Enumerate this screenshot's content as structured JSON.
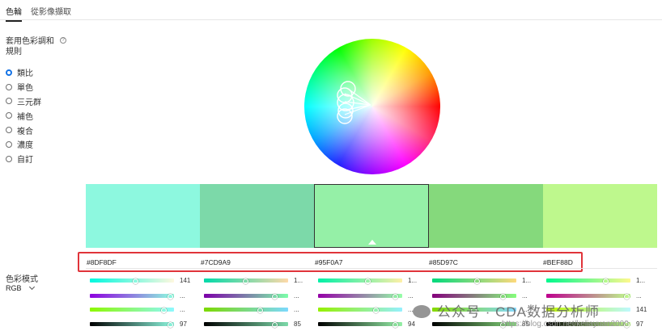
{
  "tabs": [
    {
      "label": "色輪",
      "active": true
    },
    {
      "label": "從影像擷取",
      "active": false
    }
  ],
  "harmony": {
    "title": "套用色彩調和規則",
    "rules": [
      {
        "label": "類比",
        "checked": true
      },
      {
        "label": "單色",
        "checked": false
      },
      {
        "label": "三元群",
        "checked": false
      },
      {
        "label": "補色",
        "checked": false
      },
      {
        "label": "複合",
        "checked": false
      },
      {
        "label": "濃度",
        "checked": false
      },
      {
        "label": "自訂",
        "checked": false
      }
    ]
  },
  "swatches": [
    {
      "hex": "#8DF8DF",
      "color": "#8DF8DF"
    },
    {
      "hex": "#7CD9A9",
      "color": "#7CD9A9"
    },
    {
      "hex": "#95F0A7",
      "color": "#95F0A7",
      "selected": true
    },
    {
      "hex": "#85D97C",
      "color": "#85D97C"
    },
    {
      "hex": "#BEF88D",
      "color": "#BEF88D"
    }
  ],
  "color_mode": {
    "label": "色彩模式",
    "value": "RGB"
  },
  "sliders": [
    {
      "values": [
        "141",
        "...",
        "...",
        "97"
      ]
    },
    {
      "values": [
        "1...",
        "...",
        "...",
        "85"
      ]
    },
    {
      "values": [
        "1...",
        "...",
        "...",
        "94"
      ]
    },
    {
      "values": [
        "1...",
        "...",
        "...",
        "85"
      ]
    },
    {
      "values": [
        "1...",
        "...",
        "141",
        "97"
      ]
    }
  ],
  "watermark": {
    "text": "公众号 · CDA数据分析师",
    "url": "https://blog.csdn.net/keliayuan2000"
  }
}
